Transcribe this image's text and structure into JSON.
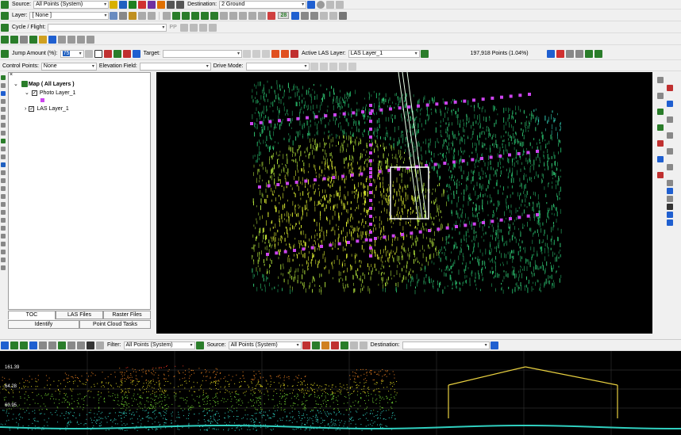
{
  "toolbar1": {
    "source_label": "Source:",
    "source_value": "All Points (System)",
    "destination_label": "Destination:",
    "destination_value": "2 Ground"
  },
  "toolbar2": {
    "layer_label": "Layer:",
    "layer_value": "[ None ]",
    "color_mode": "28"
  },
  "toolbar3": {
    "cycle_label": "Cycle / Flight:",
    "pp_label": "PP"
  },
  "toolbar5": {
    "jump_label": "Jump Amount (%):",
    "jump_value": "75",
    "target_label": "Target:",
    "active_las_label": "Active LAS Layer:",
    "active_las_value": "LAS Layer_1",
    "points_text": "197,918 Points (1.04%)"
  },
  "toolbar6": {
    "control_points_label": "Control Points:",
    "control_points_value": "None",
    "elevation_field_label": "Elevation Field:",
    "drive_mode_label": "Drive Mode:"
  },
  "toc": {
    "map_label": "Map ( All Layers )",
    "photo_layer": "Photo Layer_1",
    "las_layer": "LAS Layer_1",
    "tabs_row1": [
      "TOC",
      "LAS Files",
      "Raster Files"
    ],
    "tabs_row2": [
      "Identify",
      "Point Cloud Tasks"
    ]
  },
  "profile_bar": {
    "filter_label": "Filter:",
    "filter_value": "All Points (System)",
    "source_label": "Source:",
    "source_value": "All Points (System)",
    "destination_label": "Destination:"
  },
  "profile_axis": [
    "161.39",
    "64.28",
    "60.95"
  ],
  "colors": {
    "selection_box": "#ffffff",
    "control_points": "#cc44ee",
    "high_points": "#e03020",
    "low_points": "#30d0c0"
  }
}
